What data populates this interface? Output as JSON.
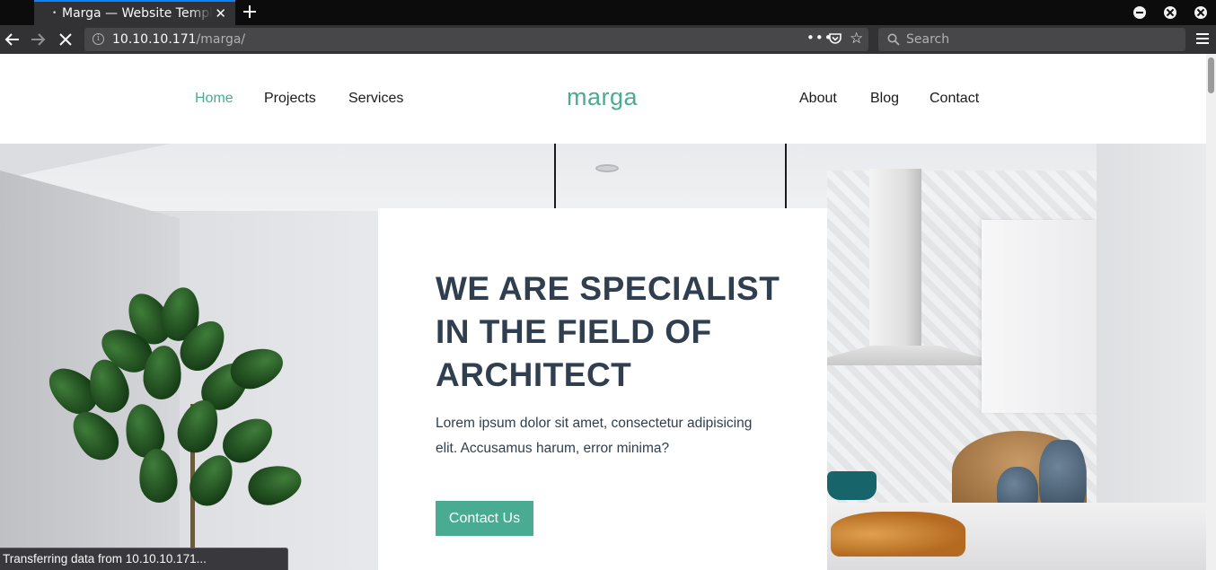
{
  "browser": {
    "tab": {
      "title": "Marga — Website Template"
    },
    "url": {
      "host": "10.10.10.171",
      "path": "/marga/"
    },
    "search": {
      "placeholder": "Search"
    },
    "status": "Transferring data from 10.10.10.171..."
  },
  "site": {
    "logo": "marga",
    "nav_left": [
      "Home",
      "Projects",
      "Services"
    ],
    "nav_right": [
      "About",
      "Blog",
      "Contact"
    ],
    "active_nav": "Home",
    "accent_color": "#4aab93",
    "hero": {
      "title": "WE ARE SPECIALIST IN THE FIELD OF ARCHITECT",
      "text": "Lorem ipsum dolor sit amet, consectetur adipisicing elit. Accusamus harum, error minima?",
      "button": "Contact Us"
    }
  },
  "icons": {
    "back": "arrow-left-icon",
    "forward": "arrow-right-icon",
    "stop": "close-icon",
    "site_info": "info-icon",
    "page_actions": "more-horizontal-icon",
    "pocket": "pocket-icon",
    "bookmark": "star-icon",
    "search": "search-icon",
    "menu": "hamburger-menu-icon"
  }
}
